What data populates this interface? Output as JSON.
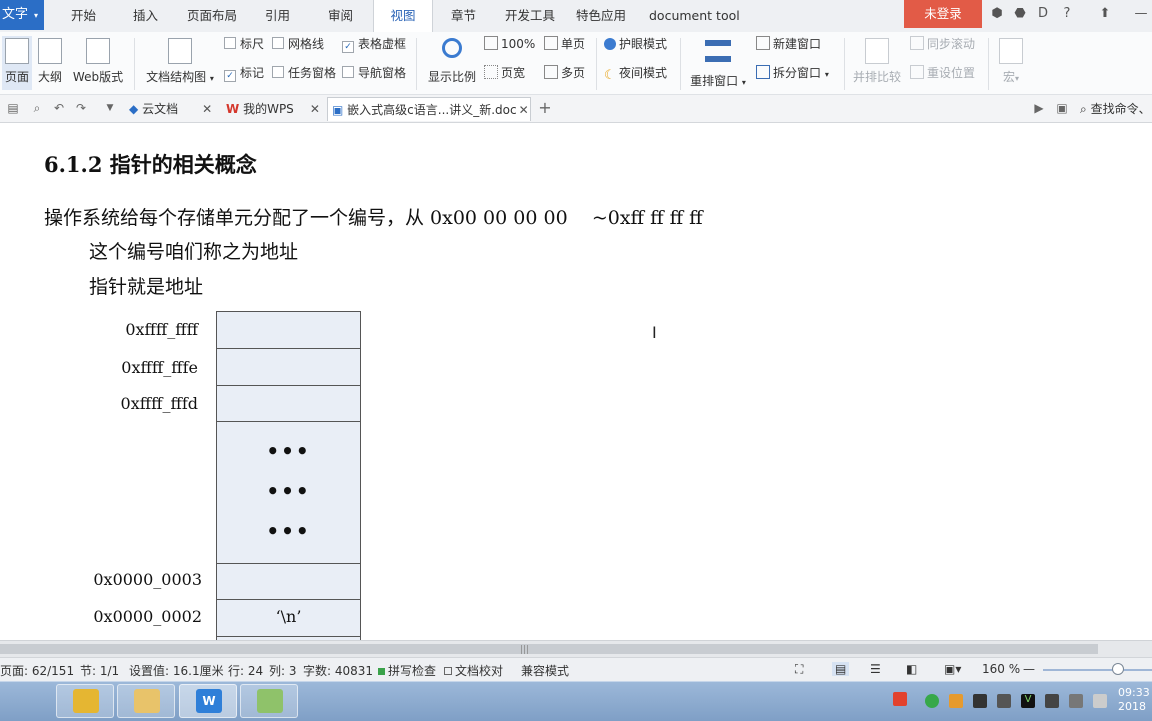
{
  "menubar": {
    "app_label": "文字",
    "items": [
      "开始",
      "插入",
      "页面布局",
      "引用",
      "审阅",
      "视图",
      "章节",
      "开发工具",
      "特色应用",
      "document tool"
    ],
    "login": "未登录",
    "colors": {
      "app_blue": "#2b6ec6",
      "login_red": "#e25b47"
    }
  },
  "ribbon": {
    "view_buttons": [
      "页面",
      "大纲",
      "Web版式"
    ],
    "doc_structure": "文档结构图",
    "checks": [
      {
        "label": "标尺",
        "checked": false
      },
      {
        "label": "网格线",
        "checked": false
      },
      {
        "label": "表格虚框",
        "checked": true
      },
      {
        "label": "标记",
        "checked": true
      },
      {
        "label": "任务窗格",
        "checked": false
      },
      {
        "label": "导航窗格",
        "checked": false
      }
    ],
    "zoom_label": "显示比例",
    "zoom_100": "100%",
    "page_width": "页宽",
    "single_page": "单页",
    "multi_page": "多页",
    "eye_mode": "护眼模式",
    "night_mode": "夜间模式",
    "rearrange": "重排窗口",
    "new_window": "新建窗口",
    "split_window": "拆分窗口",
    "side_by_side": "并排比较",
    "sync_scroll": "同步滚动",
    "reset_pos": "重设位置",
    "macro": "宏"
  },
  "tabs": {
    "cloud": "云文档",
    "mywps": "我的WPS",
    "active_doc": "嵌入式高级c语言...讲义_新.doc",
    "search_cmd": "查找命令、"
  },
  "document": {
    "heading": "6.1.2  指针的相关概念",
    "line1": "操作系统给每个存储单元分配了一个编号，从 0x00 00 00 00    ~0xff ff ff ff",
    "line2": "这个编号咱们称之为地址",
    "line3": "指针就是地址",
    "addresses": [
      "0xffff_ffff",
      "0xffff_fffe",
      "0xffff_fffd",
      "0x0000_0003",
      "0x0000_0002"
    ],
    "ellipsis": [
      "•••",
      "•••",
      "•••"
    ],
    "cell_value": "‘\\n’"
  },
  "status": {
    "page": "页面: 62/151",
    "section": "节: 1/1",
    "setting": "设置值: 16.1厘米",
    "row": "行: 24",
    "col": "列: 3",
    "words": "字数: 40831",
    "spell": "拼写检查",
    "proof": "文档校对",
    "compat": "兼容模式",
    "zoom": "160 %"
  },
  "taskbar": {
    "clock_time": "09:33",
    "clock_date": "2018"
  }
}
